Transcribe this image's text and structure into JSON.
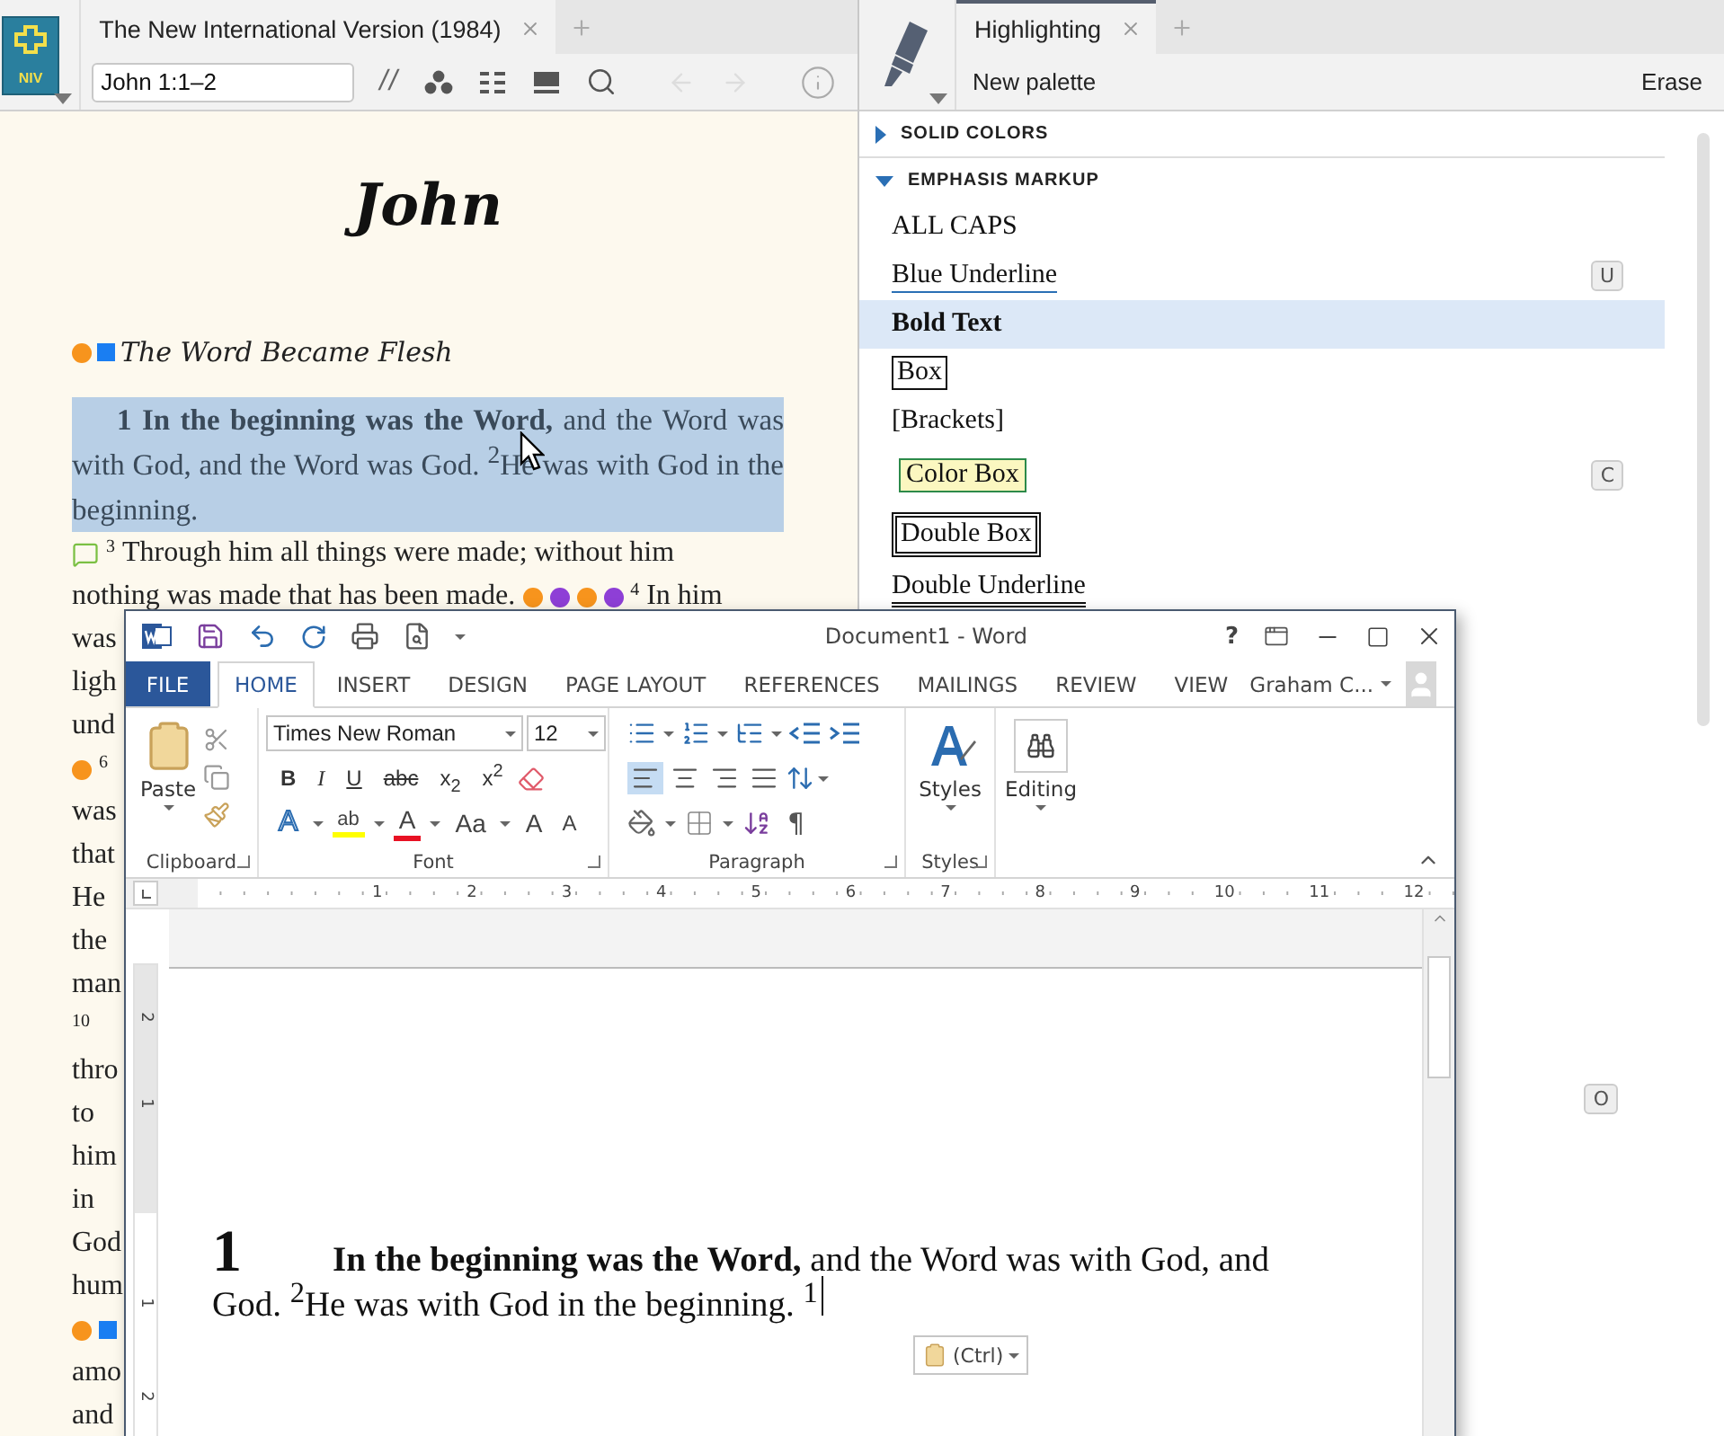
{
  "reader": {
    "logo_text": "NIV",
    "tab_title": "The New International Version (1984)",
    "reference": "John 1:1–2",
    "parallel": "//",
    "book_title": "John",
    "heading": {
      "text": "The Word Became Flesh",
      "markers": [
        {
          "kind": "dot",
          "color": "#f7941d"
        },
        {
          "kind": "square",
          "color": "#1a7ef2"
        }
      ]
    },
    "passage": {
      "text": "**1**  **In the beginning was the Word,** and the Word was with God, and the Word was God. $^{2}$He was with God in the beginning.",
      "selected": true
    },
    "lines": [
      {
        "segments": [
          {
            "kind": "comment"
          },
          {
            "kind": "verse",
            "text": "3"
          },
          {
            "kind": "text",
            "text": "Through him all things were made; without him"
          }
        ]
      },
      {
        "segments": [
          {
            "kind": "text",
            "text": "nothing was made that has been made."
          },
          {
            "kind": "dot",
            "color": "#f7941d"
          },
          {
            "kind": "dot",
            "color": "#8e3fd6"
          },
          {
            "kind": "dot",
            "color": "#f7941d"
          },
          {
            "kind": "dot",
            "color": "#8e3fd6"
          },
          {
            "kind": "verse",
            "text": "4"
          },
          {
            "kind": "text",
            "text": "In him"
          }
        ]
      },
      {
        "segments": [
          {
            "kind": "text",
            "text": "was"
          }
        ]
      },
      {
        "segments": [
          {
            "kind": "text",
            "text": "ligh"
          }
        ]
      },
      {
        "segments": [
          {
            "kind": "text",
            "text": "und"
          }
        ]
      },
      {
        "segments": [
          {
            "kind": "dot",
            "color": "#f7941d"
          },
          {
            "kind": "verse",
            "text": "6"
          }
        ]
      },
      {
        "segments": [
          {
            "kind": "text",
            "text": "was"
          }
        ]
      },
      {
        "segments": [
          {
            "kind": "text",
            "text": "that"
          }
        ]
      },
      {
        "segments": [
          {
            "kind": "text",
            "text": "He"
          }
        ]
      },
      {
        "segments": [
          {
            "kind": "text",
            "text": "the"
          }
        ]
      },
      {
        "segments": [
          {
            "kind": "text",
            "text": "man"
          }
        ]
      },
      {
        "segments": [
          {
            "kind": "verse",
            "text": "10"
          }
        ]
      },
      {
        "segments": [
          {
            "kind": "text",
            "text": "thro"
          }
        ]
      },
      {
        "segments": [
          {
            "kind": "text",
            "text": "to"
          }
        ]
      },
      {
        "segments": [
          {
            "kind": "text",
            "text": "him"
          }
        ]
      },
      {
        "segments": [
          {
            "kind": "text",
            "text": "in"
          }
        ]
      },
      {
        "segments": [
          {
            "kind": "text",
            "text": "God"
          }
        ]
      },
      {
        "segments": [
          {
            "kind": "text",
            "text": "hum"
          }
        ]
      },
      {
        "segments": [
          {
            "kind": "dot",
            "color": "#f7941d"
          },
          {
            "kind": "square",
            "color": "#1a7ef2"
          }
        ]
      },
      {
        "segments": [
          {
            "kind": "text",
            "text": "amo"
          }
        ]
      },
      {
        "segments": [
          {
            "kind": "text",
            "text": "and"
          }
        ]
      }
    ]
  },
  "highlighting": {
    "tab_title": "Highlighting",
    "palette": "New palette",
    "erase": "Erase",
    "sections": [
      {
        "title": "SOLID COLORS",
        "expanded": false
      },
      {
        "title": "EMPHASIS MARKUP",
        "expanded": true,
        "items": [
          {
            "label": "ALL CAPS",
            "kind": "plain",
            "selected": false
          },
          {
            "label": "Blue Underline",
            "kind": "underline",
            "shortcut": "U",
            "selected": false
          },
          {
            "label": "Bold Text",
            "kind": "bold",
            "selected": true
          },
          {
            "label": "Box",
            "kind": "box",
            "selected": false
          },
          {
            "label": "[Brackets]",
            "kind": "plain",
            "selected": false
          },
          {
            "label": "Color Box",
            "kind": "colorbox",
            "shortcut": "C",
            "selected": false
          },
          {
            "label": "Double Box",
            "kind": "doublebox",
            "selected": false
          },
          {
            "label": "Double Underline",
            "kind": "doubleunderline",
            "selected": false
          }
        ],
        "hidden_item_shortcut": "O"
      }
    ]
  },
  "word": {
    "title": "Document1 - Word",
    "help": "?",
    "tabs": [
      {
        "label": "FILE",
        "kind": "file",
        "selected": false
      },
      {
        "label": "HOME",
        "kind": "tab",
        "selected": true
      },
      {
        "label": "INSERT",
        "kind": "tab",
        "selected": false
      },
      {
        "label": "DESIGN",
        "kind": "tab",
        "selected": false
      },
      {
        "label": "PAGE LAYOUT",
        "kind": "tab",
        "selected": false
      },
      {
        "label": "REFERENCES",
        "kind": "tab",
        "selected": false
      },
      {
        "label": "MAILINGS",
        "kind": "tab",
        "selected": false
      },
      {
        "label": "REVIEW",
        "kind": "tab",
        "selected": false
      },
      {
        "label": "VIEW",
        "kind": "tab",
        "selected": false
      }
    ],
    "user": "Graham C...",
    "clipboard": {
      "paste": "Paste",
      "label": "Clipboard"
    },
    "font": {
      "name": "Times New Roman",
      "size": "12",
      "format_buttons": [
        {
          "kind": "bold",
          "text": "B"
        },
        {
          "kind": "italic",
          "text": "I"
        },
        {
          "kind": "underline",
          "text": "U"
        },
        {
          "kind": "strike",
          "text": "abc"
        },
        {
          "kind": "sub",
          "text": "x$_{2}$"
        },
        {
          "kind": "super",
          "text": "x$^{2}$"
        }
      ],
      "effect_buttons": [
        {
          "kind": "effects",
          "text": "A"
        },
        {
          "kind": "highlight",
          "text": "ab"
        },
        {
          "kind": "color",
          "text": "A"
        },
        {
          "kind": "case",
          "text": "Aa"
        },
        {
          "kind": "grow",
          "text": "A"
        },
        {
          "kind": "shrink",
          "text": "A"
        }
      ],
      "label": "Font"
    },
    "paragraph": {
      "alignments": [
        {
          "kind": "left",
          "selected": true
        },
        {
          "kind": "center",
          "selected": false
        },
        {
          "kind": "right",
          "selected": false
        },
        {
          "kind": "justify",
          "selected": false
        }
      ],
      "pilcrow": "¶",
      "label": "Paragraph"
    },
    "styles": {
      "button": "Styles",
      "label": "Styles"
    },
    "editing": {
      "button": "Editing"
    },
    "ruler": [
      "1",
      "2",
      "3",
      "4",
      "5",
      "6",
      "7",
      "8",
      "9",
      "10",
      "11",
      "12"
    ],
    "vertical_ruler": [
      "2",
      "1",
      "1",
      "2"
    ],
    "document": {
      "verse_number": "1",
      "line_1": "**In the beginning was the Word,** and the Word was with God, and",
      "line_2": "God. $^{2}$He was with God in the beginning. $^{1}$"
    },
    "paste_options": "(Ctrl)"
  }
}
